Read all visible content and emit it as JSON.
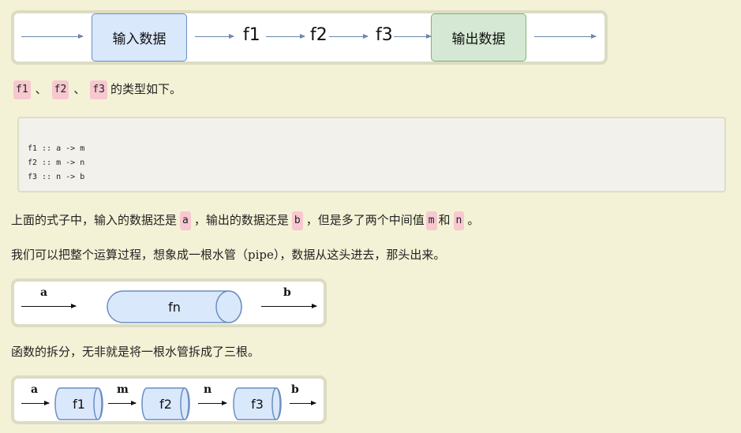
{
  "diagram1": {
    "input_label": "输入数据",
    "output_label": "输出数据",
    "functions": [
      "f1",
      "f2",
      "f3"
    ]
  },
  "sentence1": {
    "codes": [
      "f1",
      "f2",
      "f3"
    ],
    "sep": "、",
    "tail": "的类型如下。"
  },
  "code_block": {
    "lines": [
      "f1 :: a -> m",
      "f2 :: m -> n",
      "f3 :: n -> b"
    ]
  },
  "sentence2": {
    "part1": "上面的式子中，输入的数据还是",
    "code_a": "a",
    "part2": "，输出的数据还是",
    "code_b": "b",
    "part3": "，但是多了两个中间值",
    "code_m": "m",
    "part4": "和",
    "code_n": "n",
    "part5": "。"
  },
  "sentence3": "我们可以把整个运算过程，想象成一根水管（pipe），数据从这头进去，那头出来。",
  "diagram2": {
    "input": "a",
    "output": "b",
    "pipe": "fn"
  },
  "sentence4": "函数的拆分，无非就是将一根水管拆成了三根。",
  "diagram3": {
    "labels": [
      "a",
      "m",
      "n",
      "b"
    ],
    "pipes": [
      "f1",
      "f2",
      "f3"
    ]
  },
  "colors": {
    "background": "#f4f2d6",
    "code_highlight": "#f7c8d0",
    "input_box": "#dae8fc",
    "output_box": "#d5e8d4",
    "pipe_fill": "#dae8fc",
    "pipe_stroke": "#6c8ebf"
  }
}
